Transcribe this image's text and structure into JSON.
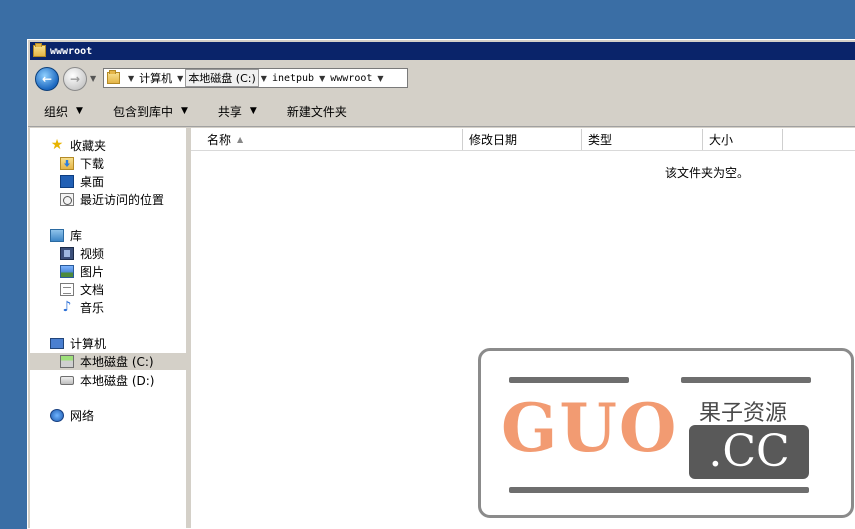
{
  "window": {
    "title": "wwwroot"
  },
  "navigation": {
    "breadcrumbs": [
      "计算机",
      "本地磁盘 (C:)",
      "inetpub",
      "wwwroot"
    ]
  },
  "toolbar": {
    "organize": "组织",
    "include_in_library": "包含到库中",
    "share": "共享",
    "new_folder": "新建文件夹"
  },
  "nav_pane": {
    "favorites": {
      "label": "收藏夹",
      "items": [
        "下载",
        "桌面",
        "最近访问的位置"
      ]
    },
    "libraries": {
      "label": "库",
      "items": [
        "视频",
        "图片",
        "文档",
        "音乐"
      ]
    },
    "computer": {
      "label": "计算机",
      "items": [
        "本地磁盘 (C:)",
        "本地磁盘 (D:)"
      ]
    },
    "network": {
      "label": "网络"
    }
  },
  "columns": {
    "name": "名称",
    "date_modified": "修改日期",
    "type": "类型",
    "size": "大小"
  },
  "content": {
    "empty_message": "该文件夹为空。"
  },
  "watermark": {
    "big": "GUO",
    "domain": ".CC",
    "cn": "果子资源"
  },
  "colors": {
    "desktop": "#3a6ea5",
    "titlebar": "#0a246a",
    "chrome": "#d4d0c8"
  }
}
